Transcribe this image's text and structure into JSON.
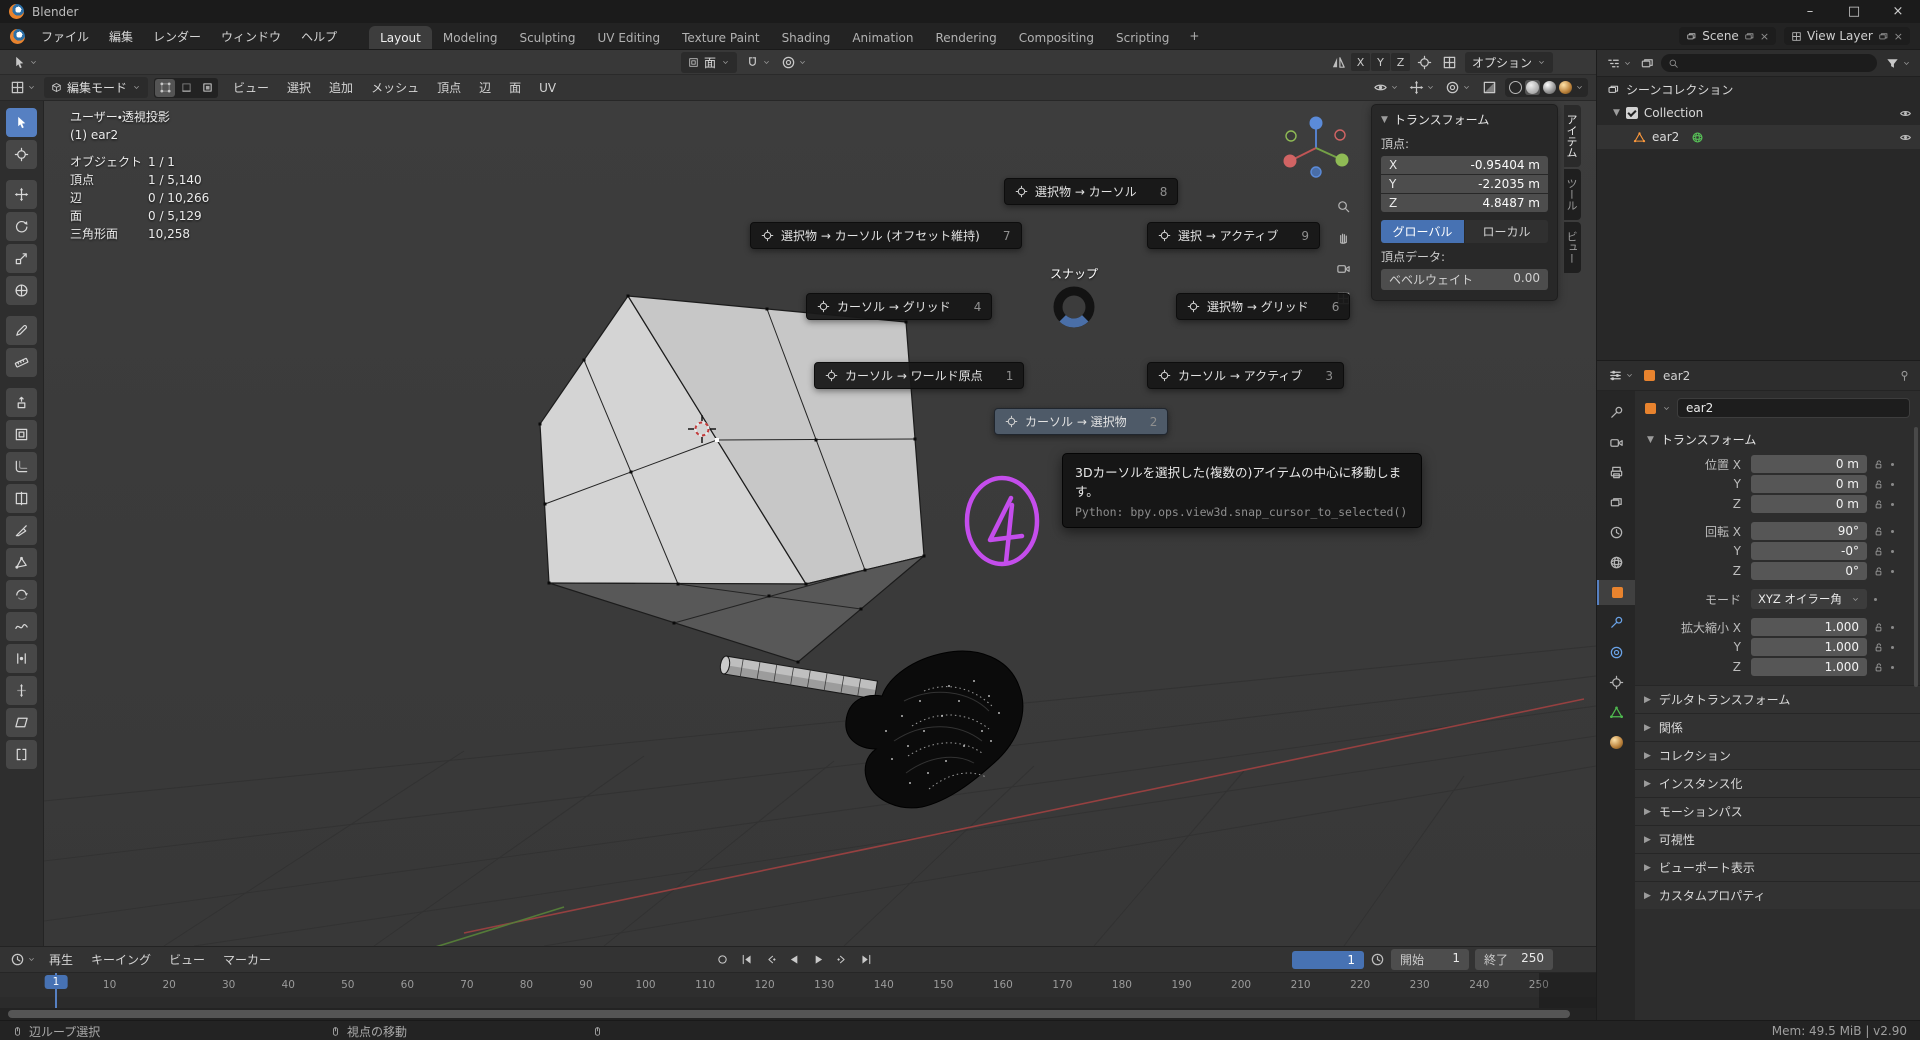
{
  "titlebar": {
    "app_title": "Blender",
    "minimize": "–",
    "maximize": "□",
    "close": "×"
  },
  "topbar": {
    "menus": [
      {
        "label": "ファイル"
      },
      {
        "label": "編集"
      },
      {
        "label": "レンダー"
      },
      {
        "label": "ウィンドウ"
      },
      {
        "label": "ヘルプ"
      }
    ],
    "workspaces": [
      {
        "label": "Layout",
        "active": true
      },
      {
        "label": "Modeling"
      },
      {
        "label": "Sculpting"
      },
      {
        "label": "UV Editing"
      },
      {
        "label": "Texture Paint"
      },
      {
        "label": "Shading"
      },
      {
        "label": "Animation"
      },
      {
        "label": "Rendering"
      },
      {
        "label": "Compositing"
      },
      {
        "label": "Scripting"
      }
    ],
    "add_workspace": "+",
    "scene_field": {
      "label": "Scene"
    },
    "view_layer_field": {
      "label": "View Layer"
    }
  },
  "tool_header": {
    "snap_target": "面",
    "mirror_axes": [
      {
        "label": "X"
      },
      {
        "label": "Y"
      },
      {
        "label": "Z"
      }
    ],
    "options_label": "オプション"
  },
  "viewport_header": {
    "mode_label": "編集モード",
    "menus": [
      {
        "label": "ビュー"
      },
      {
        "label": "選択"
      },
      {
        "label": "追加"
      },
      {
        "label": "メッシュ"
      },
      {
        "label": "頂点"
      },
      {
        "label": "辺"
      },
      {
        "label": "面"
      },
      {
        "label": "UV"
      }
    ]
  },
  "viewport": {
    "stats": {
      "line1": "ユーザー・透視投影",
      "line2": "(1) ear2",
      "rows": [
        {
          "label": "オブジェクト",
          "value": "1 / 1"
        },
        {
          "label": "頂点",
          "value": "1 / 5,140"
        },
        {
          "label": "辺",
          "value": "0 / 10,266"
        },
        {
          "label": "面",
          "value": "0 / 5,129"
        },
        {
          "label": "三角形面",
          "value": "10,258"
        }
      ]
    },
    "pie_menu": {
      "title": "スナップ",
      "items": [
        {
          "label": "選択物 → カーソル",
          "shortcut": "8"
        },
        {
          "label": "選択物 → カーソル (オフセット維持)",
          "shortcut": "7"
        },
        {
          "label": "選択 → アクティブ",
          "shortcut": "9"
        },
        {
          "label": "カーソル → グリッド",
          "shortcut": "4"
        },
        {
          "label": "選択物 → グリッド",
          "shortcut": "6"
        },
        {
          "label": "カーソル → ワールド原点",
          "shortcut": "1"
        },
        {
          "label": "カーソル → アクティブ",
          "shortcut": "3"
        },
        {
          "label": "カーソル → 選択物",
          "shortcut": "2",
          "highlighted": true
        }
      ]
    },
    "tooltip": {
      "line1": "3Dカーソルを選択した(複数の)アイテムの中心に移動します。",
      "line2": "Python: bpy.ops.view3d.snap_cursor_to_selected()"
    },
    "annotation_number": "4"
  },
  "n_panel": {
    "title": "トランスフォーム",
    "vertex_label": "頂点:",
    "axes": [
      {
        "axis": "X",
        "value": "-0.95404 m"
      },
      {
        "axis": "Y",
        "value": "-2.2035 m"
      },
      {
        "axis": "Z",
        "value": "4.8487 m"
      }
    ],
    "orientation": [
      {
        "label": "グローバル",
        "active": true
      },
      {
        "label": "ローカル"
      }
    ],
    "vertex_data_label": "頂点データ:",
    "bevel_label": "ベベルウェイト",
    "bevel_value": "0.00",
    "tabs": [
      {
        "label": "アイテム",
        "active": true
      },
      {
        "label": "ツール"
      },
      {
        "label": "ビュー"
      }
    ]
  },
  "outliner": {
    "scene_collection": "シーンコレクション",
    "collection": "Collection",
    "object": "ear2"
  },
  "properties": {
    "breadcrumb_object": "ear2",
    "name_value": "ear2",
    "transform_title": "トランスフォーム",
    "location_rows": [
      {
        "label": "位置 X",
        "value": "0 m"
      },
      {
        "label": "Y",
        "value": "0 m"
      },
      {
        "label": "Z",
        "value": "0 m"
      }
    ],
    "rotation_rows": [
      {
        "label": "回転 X",
        "value": "90°"
      },
      {
        "label": "Y",
        "value": "-0°"
      },
      {
        "label": "Z",
        "value": "0°"
      }
    ],
    "mode_label": "モード",
    "mode_value": "XYZ オイラー角",
    "scale_rows": [
      {
        "label": "拡大縮小 X",
        "value": "1.000"
      },
      {
        "label": "Y",
        "value": "1.000"
      },
      {
        "label": "Z",
        "value": "1.000"
      }
    ],
    "sections": [
      "デルタトランスフォーム",
      "関係",
      "コレクション",
      "インスタンス化",
      "モーションパス",
      "可視性",
      "ビューポート表示",
      "カスタムプロパティ"
    ]
  },
  "timeline": {
    "menus": [
      {
        "label": "再生"
      },
      {
        "label": "キーイング"
      },
      {
        "label": "ビュー"
      },
      {
        "label": "マーカー"
      }
    ],
    "current_frame": "1",
    "playhead_frame": "1",
    "start_label": "開始",
    "start_value": "1",
    "end_label": "終了",
    "end_value": "250",
    "ticks": [
      1,
      10,
      20,
      30,
      40,
      50,
      60,
      70,
      80,
      90,
      100,
      110,
      120,
      130,
      140,
      150,
      160,
      170,
      180,
      190,
      200,
      210,
      220,
      230,
      240,
      250
    ]
  },
  "statusbar": {
    "hint1": "辺ループ選択",
    "hint2": "視点の移動",
    "right": "Mem: 49.5 MiB | v2.90"
  },
  "colors": {
    "accent": "#4772b3",
    "highlight": "#5680c2",
    "orange": "#e8832e",
    "annotation": "#c44dec"
  }
}
